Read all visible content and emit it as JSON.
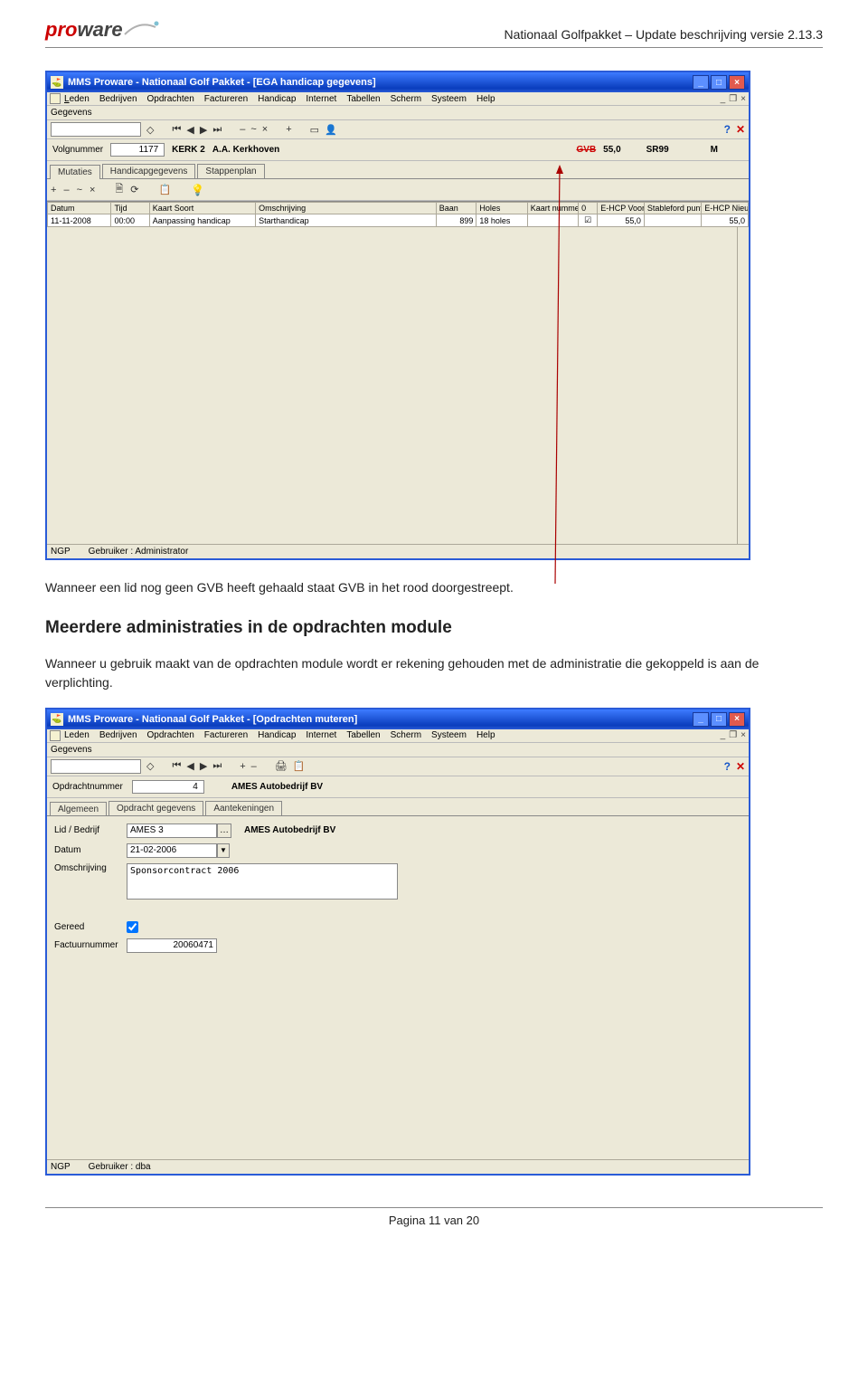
{
  "header": {
    "logo_pro": "pro",
    "logo_ware": "ware",
    "doc_title": "Nationaal Golfpakket – Update beschrijving versie 2.13.3"
  },
  "win1": {
    "title": "MMS Proware - Nationaal Golf Pakket - [EGA handicap gegevens]",
    "menu": [
      "Leden",
      "Bedrijven",
      "Opdrachten",
      "Factureren",
      "Handicap",
      "Internet",
      "Tabellen",
      "Scherm",
      "Systeem",
      "Help"
    ],
    "section": "Gegevens",
    "volgnr_label": "Volgnummer",
    "volgnr": "1177",
    "code": "KERK 2",
    "naam": "A.A. Kerkhoven",
    "gvb": "GVB",
    "hcp": "55,0",
    "sr": "SR99",
    "gender": "M",
    "tabs": [
      "Mutaties",
      "Handicapgegevens",
      "Stappenplan"
    ],
    "grid": {
      "headers": [
        "Datum",
        "Tijd",
        "Kaart Soort",
        "Omschrijving",
        "Baan",
        "Holes",
        "Kaart nummer",
        "0",
        "E-HCP Voor",
        "Stableford punten",
        "E-HCP Nieuw"
      ],
      "row": [
        "11-11-2008",
        "00:00",
        "Aanpassing handicap",
        "Starthandicap",
        "899",
        "18 holes",
        "",
        "☑",
        "55,0",
        "",
        "55,0"
      ]
    },
    "status": {
      "left": "NGP",
      "right": "Gebruiker : Administrator"
    }
  },
  "para1": "Wanneer een lid nog geen GVB heeft gehaald staat GVB in het rood doorgestreept.",
  "heading2": "Meerdere administraties in de opdrachten module",
  "para2": "Wanneer u gebruik maakt van de opdrachten module wordt er rekening gehouden met de administratie die gekoppeld is aan de verplichting.",
  "win2": {
    "title": "MMS Proware - Nationaal Golf Pakket - [Opdrachten muteren]",
    "menu": [
      "Leden",
      "Bedrijven",
      "Opdrachten",
      "Factureren",
      "Handicap",
      "Internet",
      "Tabellen",
      "Scherm",
      "Systeem",
      "Help"
    ],
    "section": "Gegevens",
    "opdr_label": "Opdrachtnummer",
    "opdr_num": "4",
    "opdr_naam": "AMES Autobedrijf BV",
    "tabs": [
      "Algemeen",
      "Opdracht gegevens",
      "Aantekeningen"
    ],
    "form": {
      "lid_label": "Lid / Bedrijf",
      "lid_code": "AMES 3",
      "lid_naam": "AMES Autobedrijf BV",
      "datum_label": "Datum",
      "datum": "21-02-2006",
      "oms_label": "Omschrijving",
      "oms": "Sponsorcontract 2006",
      "gereed_label": "Gereed",
      "fact_label": "Factuurnummer",
      "fact": "20060471"
    },
    "status": {
      "left": "NGP",
      "right": "Gebruiker : dba"
    }
  },
  "footer": "Pagina 11 van 20"
}
